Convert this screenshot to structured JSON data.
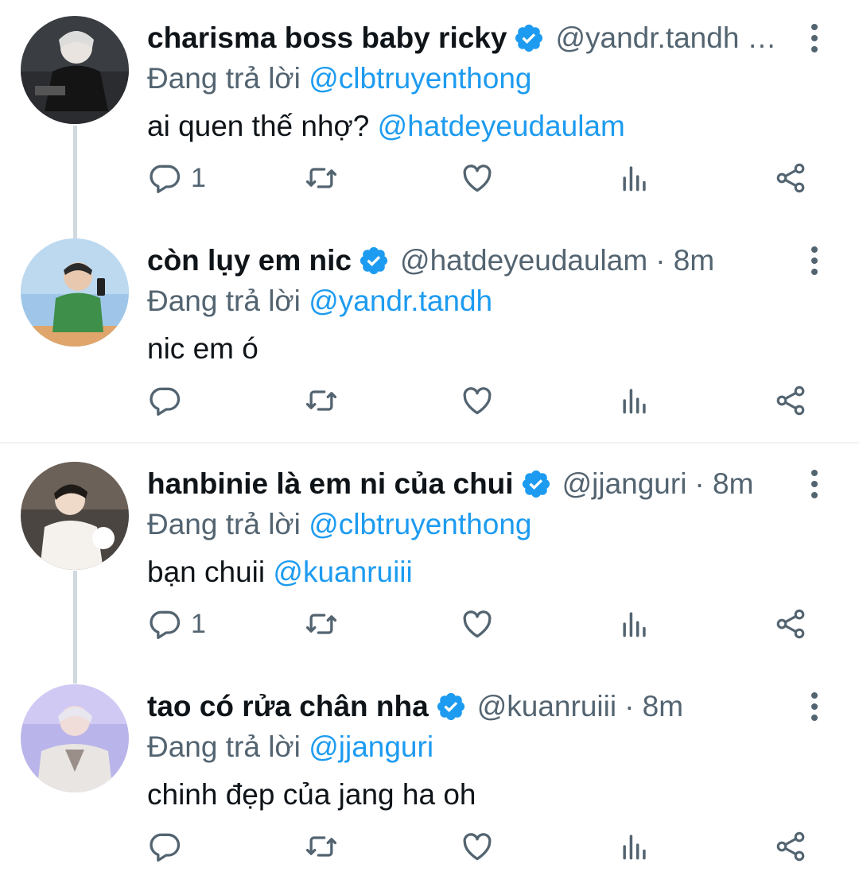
{
  "tweets": [
    {
      "name": "charisma boss baby ricky",
      "handle": "@yandr.tandh",
      "time_display": "…",
      "reply_prefix": "Đang trả lời",
      "reply_to": "@clbtruyenthong",
      "text": "ai quen thế nhợ?",
      "text_mention": "@hatdeyeudaulam",
      "reply_count": "1"
    },
    {
      "name": "còn lụy em nic",
      "handle": "@hatdeyeudaulam",
      "time_display": "· 8m",
      "reply_prefix": "Đang trả lời",
      "reply_to": "@yandr.tandh",
      "text": "nic em ó",
      "text_mention": "",
      "reply_count": ""
    },
    {
      "name": "hanbinie là em ni của chui",
      "handle": "@jjanguri",
      "time_display": "· 8m",
      "reply_prefix": "Đang trả lời",
      "reply_to": "@clbtruyenthong",
      "text": "bạn chuii",
      "text_mention": "@kuanruiii",
      "reply_count": "1"
    },
    {
      "name": "tao có rửa chân nha",
      "handle": "@kuanruiii",
      "time_display": "· 8m",
      "reply_prefix": "Đang trả lời",
      "reply_to": "@jjanguri",
      "text": "chinh đẹp của jang ha oh",
      "text_mention": "",
      "reply_count": ""
    }
  ],
  "icons": {
    "reply": "reply-icon",
    "retweet": "retweet-icon",
    "like": "heart-icon",
    "views": "views-icon",
    "share": "share-icon",
    "verified": "verified-badge-icon",
    "more": "more-options-icon"
  },
  "colors": {
    "accent": "#1d9bf0",
    "secondary_text": "#536471",
    "primary_text": "#0f1419",
    "thread_line": "#cfd9de"
  }
}
